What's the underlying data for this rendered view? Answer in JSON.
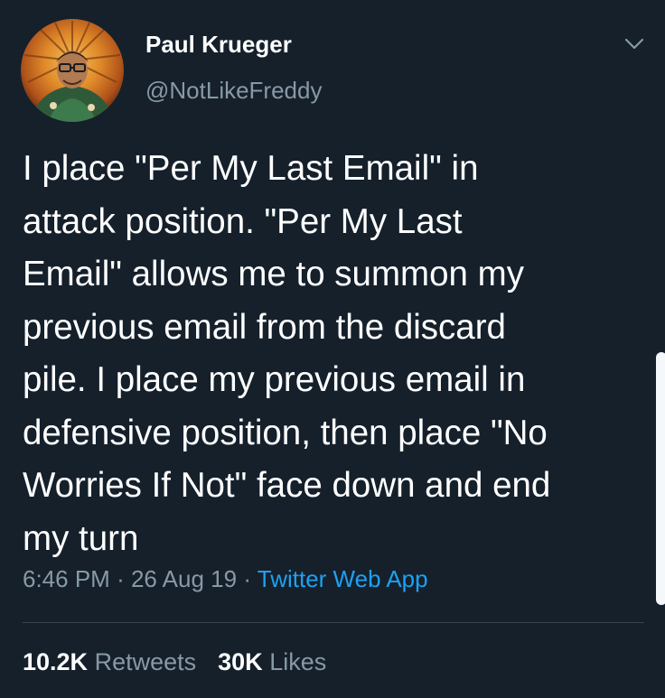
{
  "user": {
    "display_name": "Paul Krueger",
    "handle": "@NotLikeFreddy"
  },
  "tweet": {
    "lines": [
      "I place \"Per My Last Email\" in",
      "attack position. \"Per My Last",
      "Email\" allows me to summon my",
      "previous email from the discard",
      "pile. I place my previous email in",
      "defensive position, then place \"No",
      "Worries If Not\" face down and end",
      "my turn"
    ],
    "time": "6:46 PM",
    "separator": "·",
    "date": "26 Aug 19",
    "source": "Twitter Web App"
  },
  "stats": {
    "retweets_count": "10.2K",
    "retweets_label": "Retweets",
    "likes_count": "30K",
    "likes_label": "Likes"
  },
  "icons": {
    "menu": "chevron-down-icon",
    "avatar": "avatar"
  },
  "colors": {
    "background": "#15202b",
    "primary_text": "#ffffff",
    "secondary_text": "#8899a6",
    "link": "#1da1f2",
    "divider": "#38444d"
  }
}
